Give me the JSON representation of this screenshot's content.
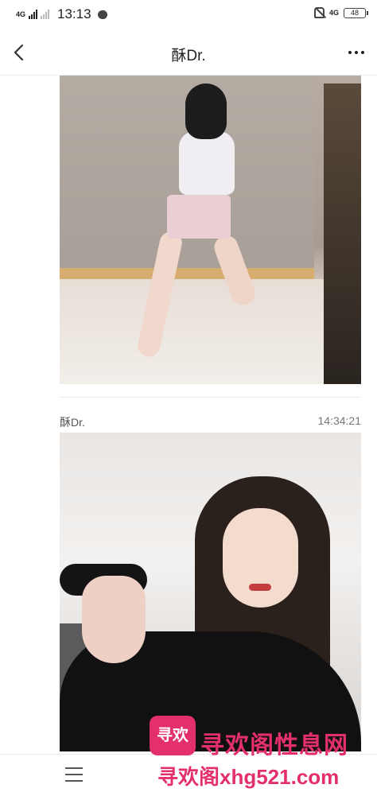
{
  "status_bar": {
    "network": "4G",
    "network_right": "4G",
    "time": "13:13",
    "battery": "48",
    "icons": [
      "signal-icon",
      "message-bubble-icon",
      "mute-icon",
      "battery-icon"
    ]
  },
  "header": {
    "title": "酥Dr.",
    "icons": [
      "back-arrow-icon",
      "more-dots-icon"
    ]
  },
  "messages": [
    {
      "type": "image",
      "description_icon": "photo-image"
    },
    {
      "sender": "酥Dr.",
      "time": "14:34:21",
      "type": "image"
    }
  ],
  "watermark": {
    "logo_text": "寻欢",
    "line1": "寻欢阁性息网",
    "line2": "寻欢阁xhg521.com"
  },
  "bottom_bar": {
    "icons": [
      "menu-icon"
    ]
  },
  "colors": {
    "watermark": "#e3306b",
    "divider": "#ececec"
  }
}
